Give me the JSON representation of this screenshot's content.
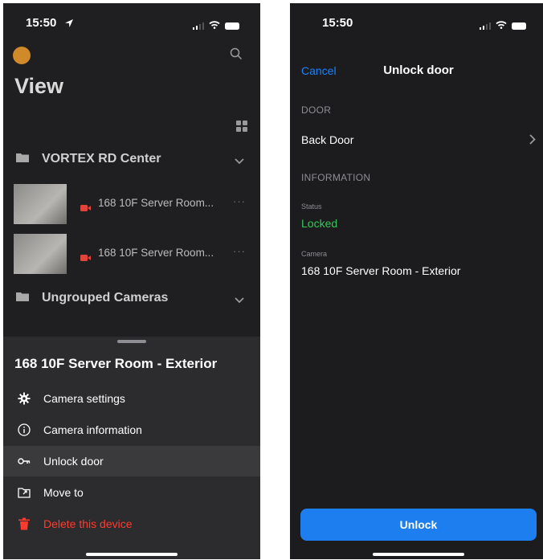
{
  "left_screen": {
    "status_time": "15:50",
    "page_title": "View",
    "group1_name": "VORTEX RD Center",
    "cameras": [
      {
        "name": "168 10F Server Room..."
      },
      {
        "name": "168 10F Server Room..."
      }
    ],
    "group2_name": "Ungrouped Cameras",
    "sheet": {
      "title": "168 10F Server Room - Exterior",
      "items": [
        {
          "label": "Camera settings",
          "icon": "gear-icon"
        },
        {
          "label": "Camera information",
          "icon": "info-icon"
        },
        {
          "label": "Unlock door",
          "icon": "key-icon"
        },
        {
          "label": "Move to",
          "icon": "move-icon"
        },
        {
          "label": "Delete this device",
          "icon": "trash-icon"
        }
      ]
    }
  },
  "right_screen": {
    "status_time": "15:50",
    "cancel_label": "Cancel",
    "nav_title": "Unlock door",
    "door_section": "DOOR",
    "door_value": "Back Door",
    "info_section": "INFORMATION",
    "status_label": "Status",
    "status_value": "Locked",
    "camera_label": "Camera",
    "camera_value": "168 10F Server Room - Exterior",
    "unlock_label": "Unlock"
  },
  "colors": {
    "accent_blue": "#1d7ef0",
    "status_green": "#35c759",
    "danger_red": "#ff3b30"
  }
}
